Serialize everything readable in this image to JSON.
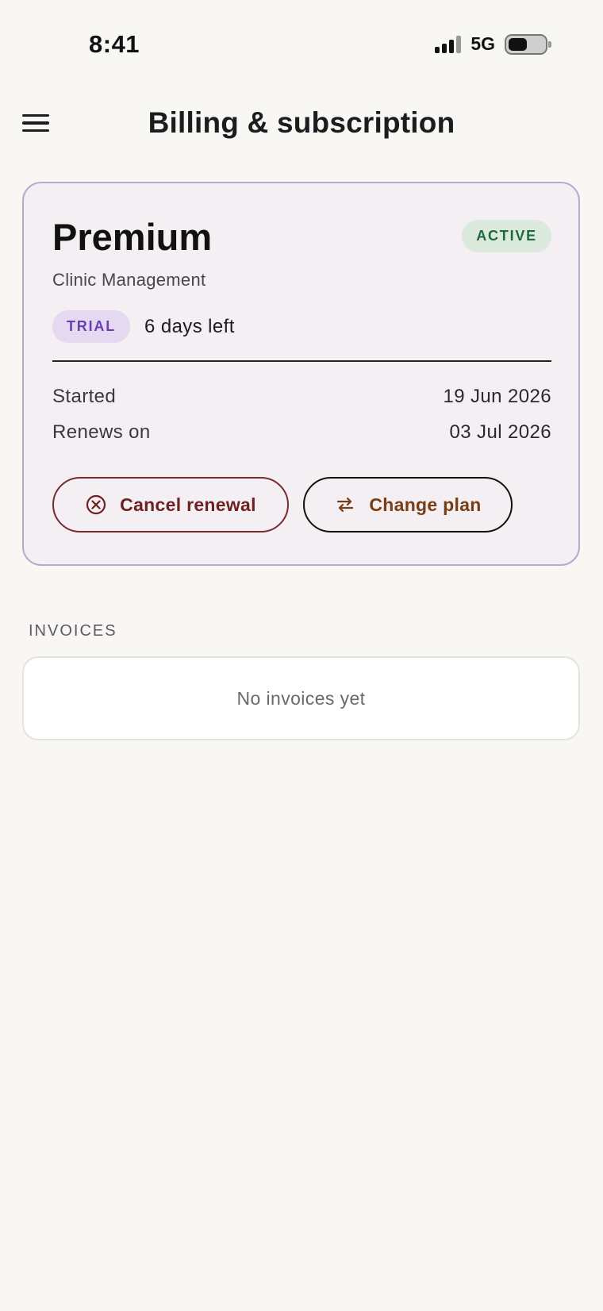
{
  "status_bar": {
    "time": "8:41",
    "network": "5G",
    "battery_level": 0.52
  },
  "header": {
    "title": "Billing & subscription",
    "menu_icon": "hamburger-menu-icon"
  },
  "plan": {
    "name": "Premium",
    "status_badge": "ACTIVE",
    "subtitle": "Clinic Management",
    "trial_badge": "TRIAL",
    "days_left": "6 days left",
    "started_label": "Started",
    "started_value": "19 Jun 2026",
    "renews_label": "Renews on",
    "renews_value": "03 Jul 2026",
    "cancel_label": "Cancel renewal",
    "cancel_icon": "cancel-circle-icon",
    "change_label": "Change plan",
    "change_icon": "swap-arrows-icon"
  },
  "invoices": {
    "section_label": "INVOICES",
    "empty_text": "No invoices yet"
  },
  "colors": {
    "background": "#f8f7f3",
    "card_border": "#b8a9cf",
    "active_badge_bg": "#dce9dd",
    "active_badge_text": "#1e6a3c",
    "trial_badge_bg": "#e5d9f2",
    "trial_badge_text": "#6a3fb0",
    "cancel_color": "#6e1f1f",
    "change_color": "#7a3d12"
  }
}
